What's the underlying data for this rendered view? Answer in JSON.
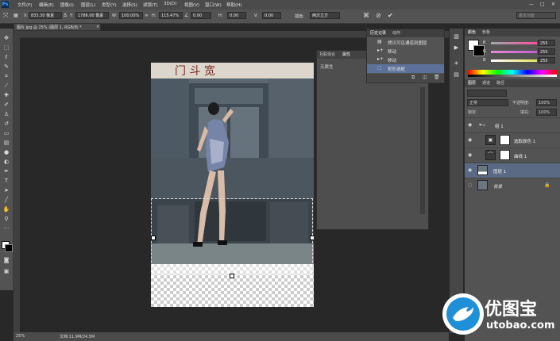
{
  "app": {
    "logo": "Ps"
  },
  "menu": [
    "文件(F)",
    "编辑(E)",
    "图像(I)",
    "图层(L)",
    "类型(Y)",
    "选择(S)",
    "滤镜(T)",
    "3D(D)",
    "视图(V)",
    "窗口(W)",
    "帮助(H)"
  ],
  "window_controls": [
    "—",
    "□",
    "✕"
  ],
  "options": {
    "x_label": "X:",
    "x_value": "833.30 像素",
    "y_label": "Y:",
    "y_value": "1786.00 像素",
    "w_label": "W:",
    "w_value": "100.00%",
    "h_label": "H:",
    "h_value": "115.47%",
    "angle_value": "0.00",
    "hskew_label": "H:",
    "hskew_value": "0.00",
    "vskew_label": "V:",
    "vskew_value": "0.00",
    "interp_label": "插值:",
    "interp_value": "两次立方",
    "workspace_value": "基本功能"
  },
  "document": {
    "tab_label": "图片.jpg @ 25% (图层 1, RGB/8) *",
    "close": "×"
  },
  "status": {
    "zoom": "25%",
    "doc_info": "文档:11.9M/24.5M"
  },
  "history": {
    "tabs": [
      "历史记录",
      "动作"
    ],
    "items": [
      {
        "icon": "▤",
        "label": "拷贝可见通道到图层"
      },
      {
        "icon": "▸+",
        "label": "移动"
      },
      {
        "icon": "▸+",
        "label": "移动"
      },
      {
        "icon": "⬚",
        "label": "矩形选框"
      }
    ]
  },
  "properties": {
    "tabs": [
      "互联混合",
      "属性"
    ],
    "empty_text": "无属性"
  },
  "color_panel": {
    "tabs": [
      "颜色",
      "色板"
    ],
    "channels": [
      {
        "name": "R",
        "value": "255",
        "color": "#ff4fa0"
      },
      {
        "name": "G",
        "value": "255",
        "color": "#d25fd0"
      },
      {
        "name": "B",
        "value": "255",
        "color": "#e6e65a"
      }
    ]
  },
  "layers_panel": {
    "tabs": [
      "图层",
      "通道",
      "路径"
    ],
    "blend_mode": "正常",
    "opacity_label": "不透明度:",
    "opacity_value": "100%",
    "lock_label": "锁定:",
    "fill_label": "填充:",
    "fill_value": "100%",
    "layers": [
      {
        "name": "组 1",
        "type": "group"
      },
      {
        "name": "选取颜色 1",
        "type": "adjustment"
      },
      {
        "name": "曲线 1",
        "type": "adjustment"
      },
      {
        "name": "图层 1",
        "type": "pixel",
        "selected": true
      },
      {
        "name": "背景",
        "type": "background",
        "locked": true
      }
    ]
  },
  "colors": {
    "menu_bg": "#4b4b4b",
    "panel_bg": "#535353",
    "workspace": "#282828",
    "selected_layer": "#5a6a85",
    "history_selected": "#5c7099"
  },
  "watermark": {
    "brand": "优图宝",
    "url": "utobao.com"
  }
}
